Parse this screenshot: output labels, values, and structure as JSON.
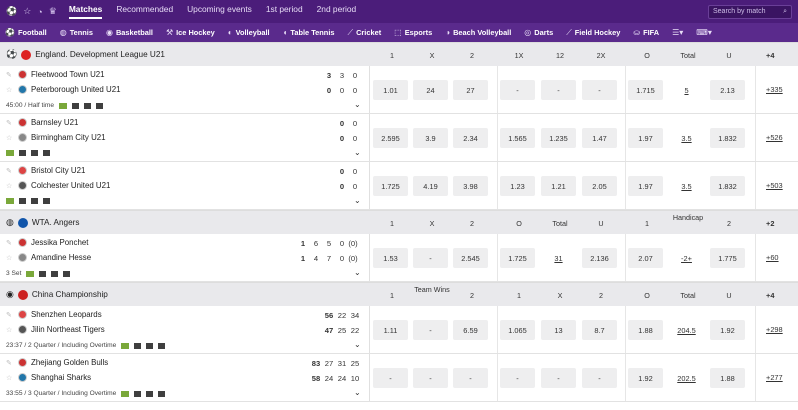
{
  "topbar": {
    "tabs": [
      "Matches",
      "Recommended",
      "Upcoming events",
      "1st period",
      "2nd period"
    ],
    "search_placeholder": "Search by match"
  },
  "sports": [
    "Football",
    "Tennis",
    "Basketball",
    "Ice Hockey",
    "Volleyball",
    "Table Tennis",
    "Cricket",
    "Esports",
    "Beach Volleyball",
    "Darts",
    "Field Hockey",
    "FIFA"
  ],
  "leagues": [
    {
      "name": "England. Development League U21",
      "cols": [
        "1",
        "X",
        "2",
        "1X",
        "12",
        "2X",
        "O",
        "Total",
        "U"
      ],
      "more": "+4",
      "matches": [
        {
          "t1": "Fleetwood Town U21",
          "t2": "Peterborough United U21",
          "s1": [
            "3",
            "3",
            "0"
          ],
          "s2": [
            "0",
            "0",
            "0"
          ],
          "meta": "45:00 / Half time",
          "odds": [
            "1.01",
            "24",
            "27",
            "-",
            "-",
            "-",
            "1.715",
            "5",
            "2.13"
          ],
          "more": "+335"
        },
        {
          "t1": "Barnsley U21",
          "t2": "Birmingham City U21",
          "s1": [
            "0",
            "0"
          ],
          "s2": [
            "0",
            "0"
          ],
          "meta": "",
          "odds": [
            "2.595",
            "3.9",
            "2.34",
            "1.565",
            "1.235",
            "1.47",
            "1.97",
            "3.5",
            "1.832"
          ],
          "more": "+526"
        },
        {
          "t1": "Bristol City U21",
          "t2": "Colchester United U21",
          "s1": [
            "0",
            "0"
          ],
          "s2": [
            "0",
            "0"
          ],
          "meta": "",
          "odds": [
            "1.725",
            "4.19",
            "3.98",
            "1.23",
            "1.21",
            "2.05",
            "1.97",
            "3.5",
            "1.832"
          ],
          "more": "+503"
        }
      ]
    },
    {
      "name": "WTA. Angers",
      "cols": [
        "1",
        "X",
        "2",
        "O",
        "Total",
        "U",
        "1",
        "Handicap",
        "2"
      ],
      "more": "+2",
      "matches": [
        {
          "t1": "Jessika Ponchet",
          "t2": "Amandine Hesse",
          "s1": [
            "1",
            "6",
            "5",
            "0",
            "(0)"
          ],
          "s2": [
            "1",
            "4",
            "7",
            "0",
            "(0)"
          ],
          "meta": "3 Set",
          "odds": [
            "1.53",
            "-",
            "2.545",
            "1.725",
            "31",
            "2.136",
            "2.07",
            "-2+",
            "1.775"
          ],
          "more": "+60"
        }
      ]
    },
    {
      "name": "China Championship",
      "cols": [
        "1",
        "Team Wins",
        "2",
        "1",
        "X",
        "2",
        "O",
        "Total",
        "U"
      ],
      "more": "+4",
      "matches": [
        {
          "t1": "Shenzhen Leopards",
          "t2": "Jilin Northeast Tigers",
          "s1": [
            "56",
            "22",
            "34"
          ],
          "s2": [
            "47",
            "25",
            "22"
          ],
          "meta": "23:37 / 2 Quarter / Including Overtime",
          "odds": [
            "1.11",
            "-",
            "6.59",
            "1.065",
            "13",
            "8.7",
            "1.88",
            "204.5",
            "1.92"
          ],
          "more": "+298"
        },
        {
          "t1": "Zhejiang Golden Bulls",
          "t2": "Shanghai Sharks",
          "s1": [
            "83",
            "27",
            "31",
            "25"
          ],
          "s2": [
            "58",
            "24",
            "24",
            "10"
          ],
          "meta": "33:55 / 3 Quarter / Including Overtime",
          "odds": [
            "-",
            "-",
            "-",
            "-",
            "-",
            "-",
            "1.92",
            "202.5",
            "1.88"
          ],
          "more": "+277"
        }
      ]
    }
  ]
}
